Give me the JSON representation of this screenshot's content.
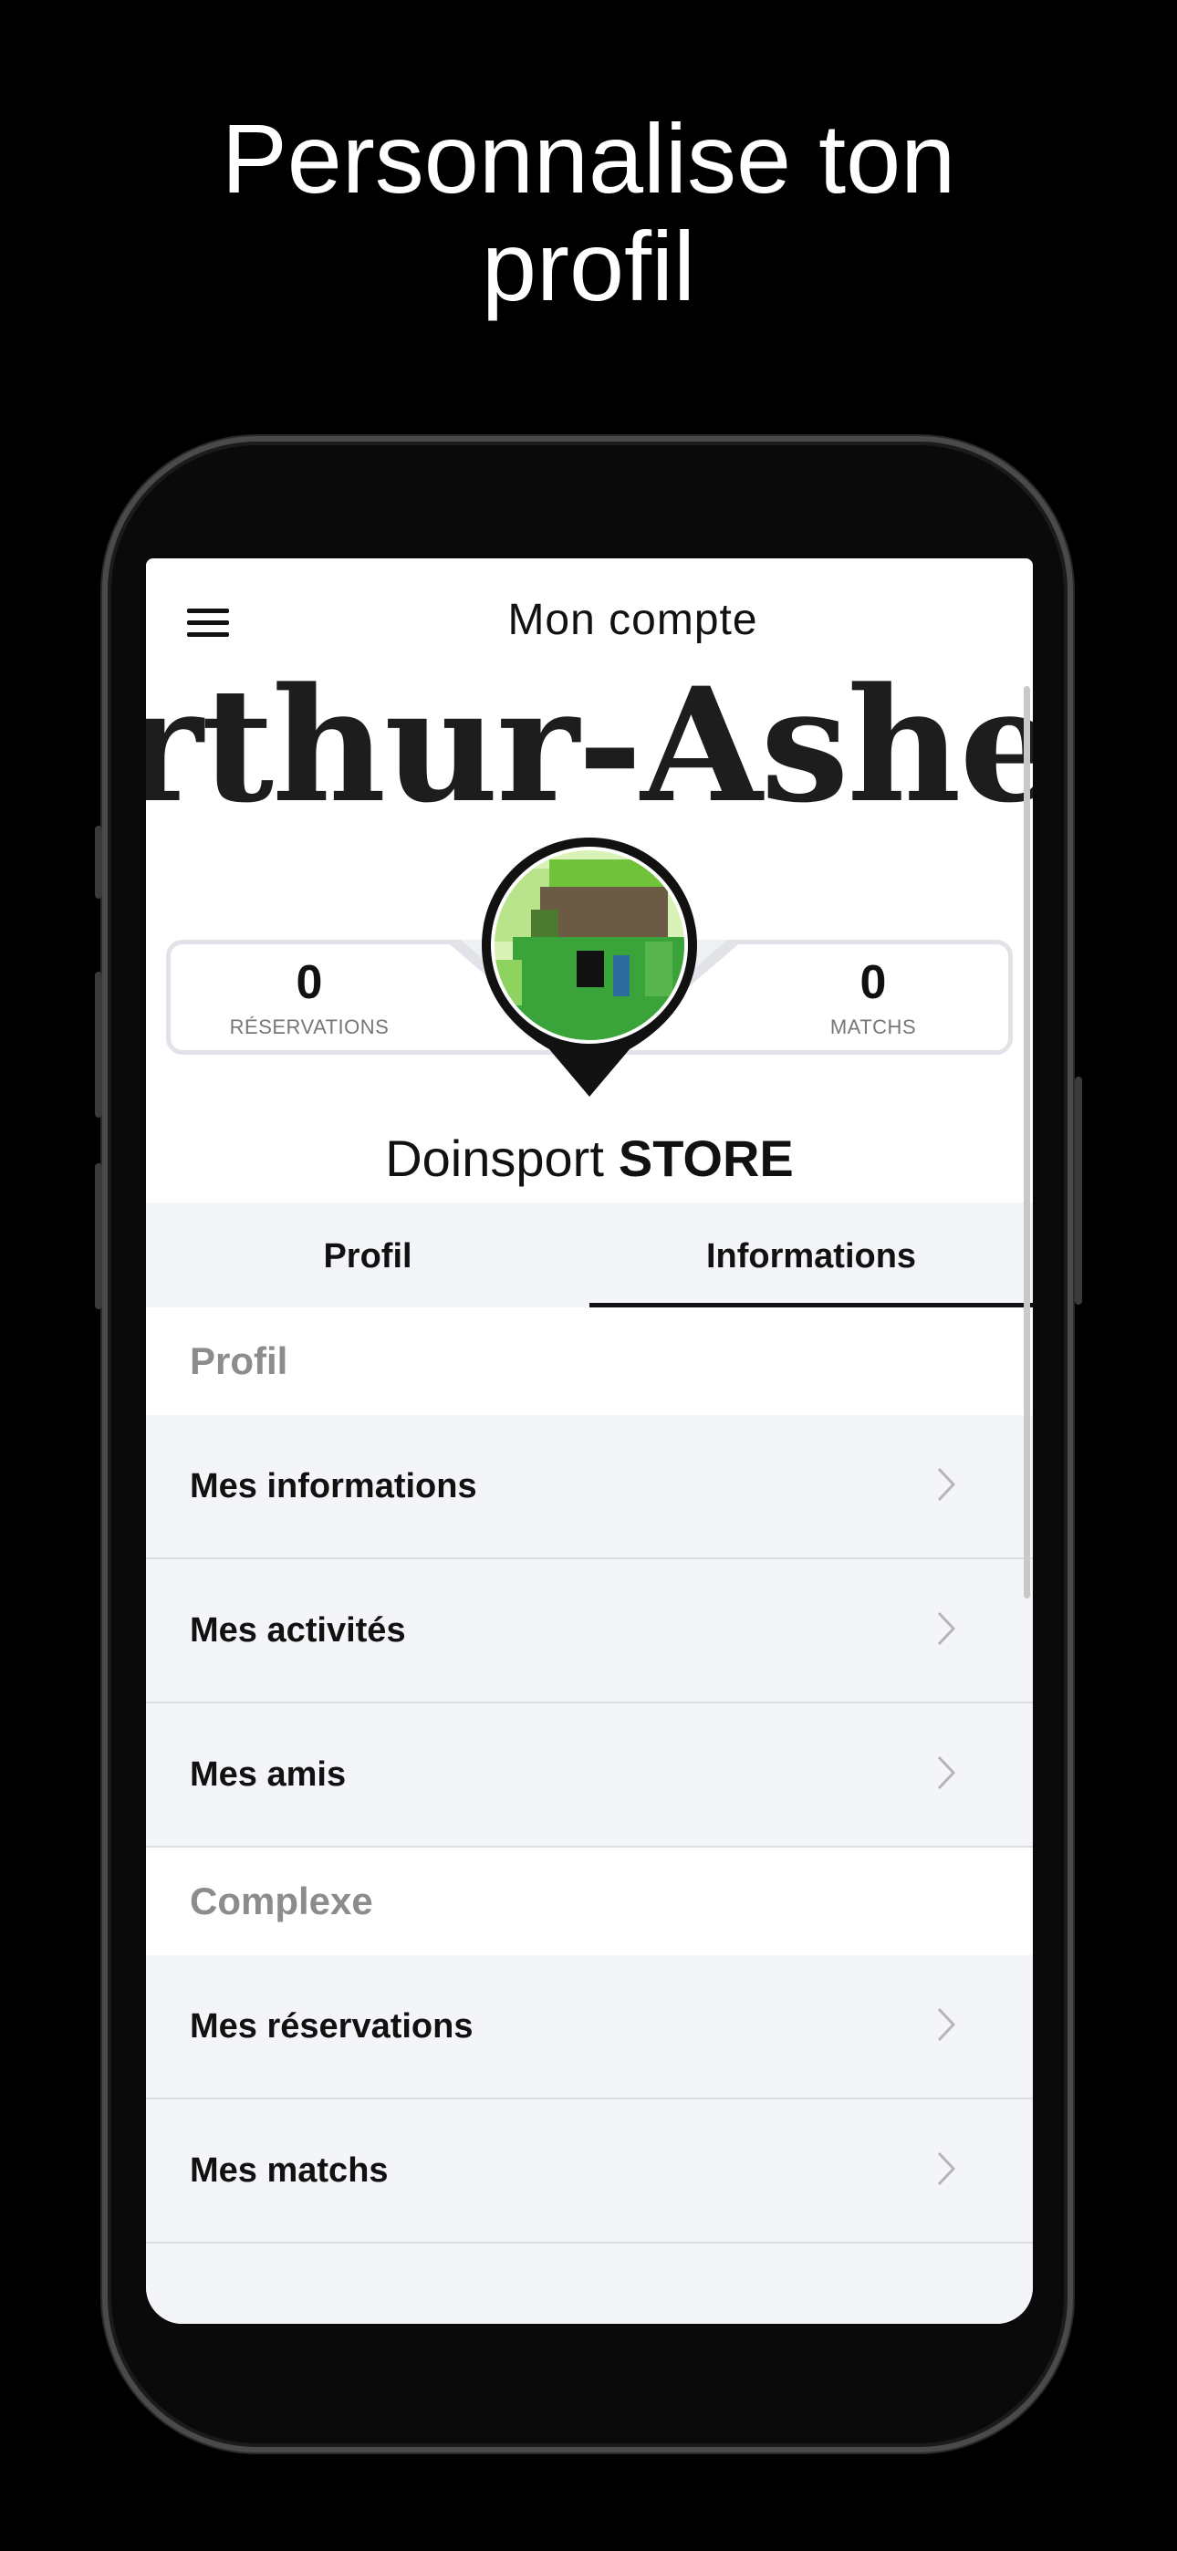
{
  "promo": {
    "headline_line1": "Personnalise ton",
    "headline_line2": "profil"
  },
  "appbar": {
    "title": "Mon compte",
    "menu_icon": "hamburger-menu-icon"
  },
  "banner": {
    "text": "rthur-Ashe"
  },
  "stats": {
    "reservations_count": "0",
    "reservations_label": "RÉSERVATIONS",
    "matchs_count": "0",
    "matchs_label": "MATCHS"
  },
  "user": {
    "first_name": "Doinsport",
    "last_name": "STORE"
  },
  "tabs": [
    {
      "label": "Profil",
      "active": false
    },
    {
      "label": "Informations",
      "active": true
    }
  ],
  "sections": [
    {
      "title": "Profil",
      "items": [
        "Mes informations",
        "Mes activités",
        "Mes amis"
      ]
    },
    {
      "title": "Complexe",
      "items": [
        "Mes réservations",
        "Mes matchs"
      ]
    }
  ],
  "colors": {
    "background": "#000000",
    "row_bg": "#f4f5f8",
    "section_text": "#8c8c8c",
    "avatar_green": "#4caf50"
  }
}
